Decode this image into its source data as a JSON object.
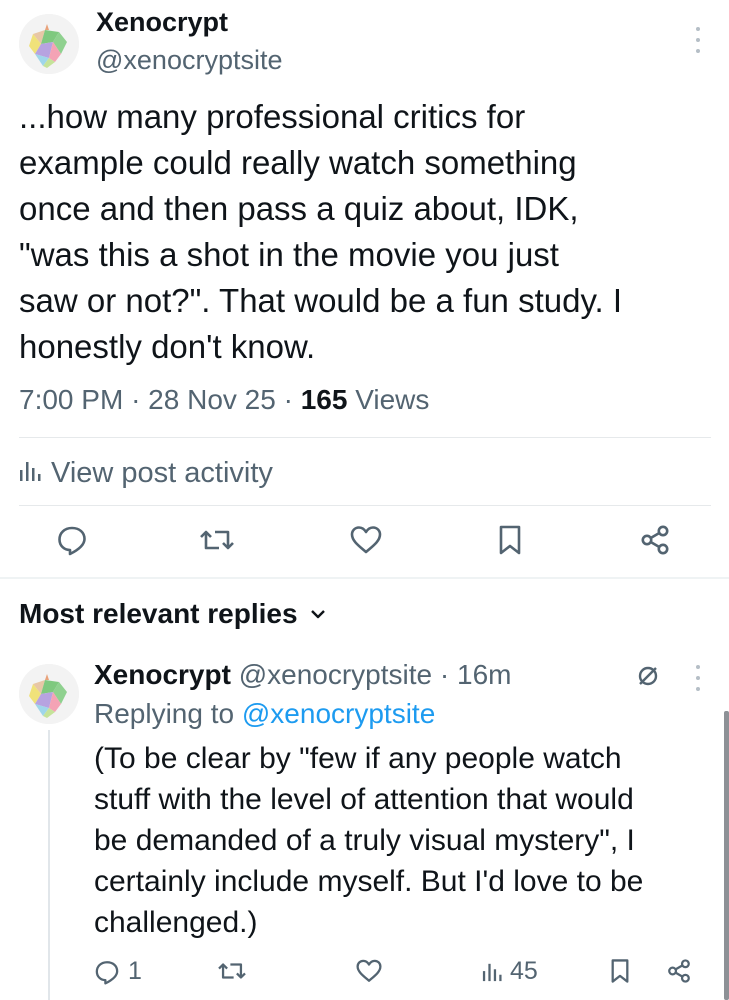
{
  "post": {
    "author_name": "Xenocrypt",
    "author_handle": "@xenocryptsite",
    "body_lines": [
      "...how many professional critics for",
      "example could really watch something",
      "once and then pass a quiz about, IDK,",
      "\"was this a shot in the movie you just",
      "saw or not?\". That would be a fun study. I",
      "honestly don't know."
    ],
    "time": "7:00 PM",
    "date": "28 Nov 25",
    "views_count": "165",
    "views_label": "Views",
    "activity_label": "View post activity"
  },
  "sort": {
    "label": "Most relevant replies"
  },
  "reply": {
    "author_name": "Xenocrypt",
    "author_handle": "@xenocryptsite",
    "time_ago": "16m",
    "replying_prefix": "Replying to",
    "replying_handle": "@xenocryptsite",
    "body_lines": [
      "(To be clear by \"few if any people watch",
      "stuff with the level of attention that would",
      "be demanded of a truly visual mystery\", I",
      "certainly include myself. But I'd love to be",
      "challenged.)"
    ],
    "reply_count": "1",
    "views_count": "45"
  },
  "icons": {
    "reply": "reply-icon",
    "repost": "repost-icon",
    "like": "like-icon",
    "bookmark": "bookmark-icon",
    "share": "share-icon",
    "analytics": "analytics-icon",
    "more": "more-vertical-icon",
    "mute": "mute-icon",
    "chevron": "chevron-down-icon"
  },
  "colors": {
    "text": "#0f1419",
    "muted": "#536471",
    "link": "#1d9bf0",
    "divider": "#e6e9eb"
  }
}
